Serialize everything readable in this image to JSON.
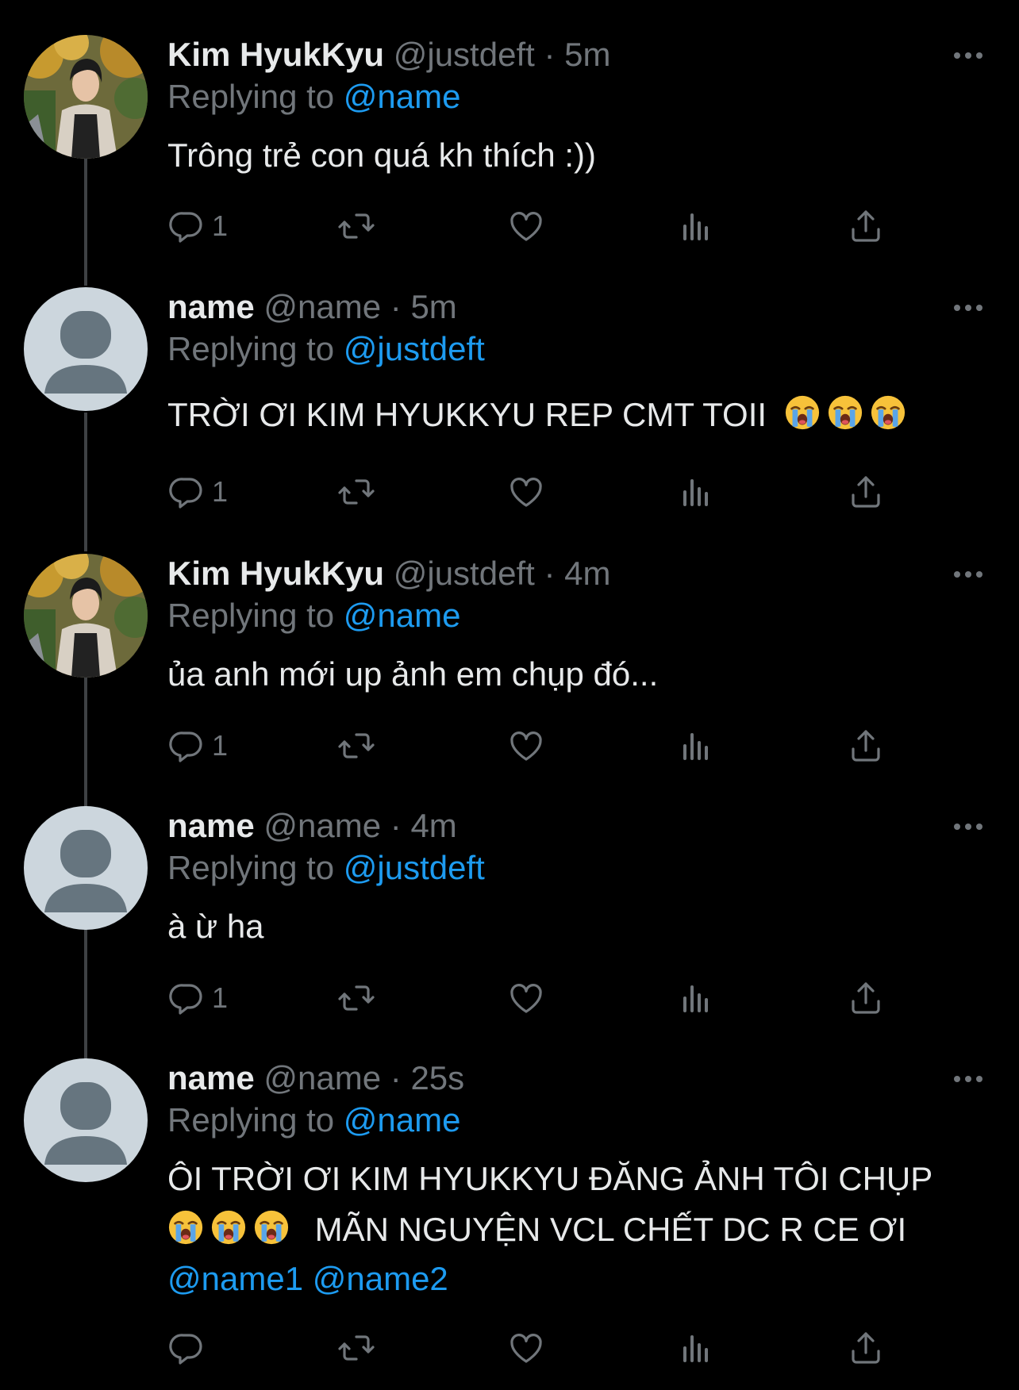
{
  "users": {
    "deft": {
      "display_name": "Kim HyukKyu",
      "handle": "@justdeft"
    },
    "name": {
      "display_name": "name",
      "handle": "@name"
    }
  },
  "tweets": [
    {
      "display_name": "Kim HyukKyu",
      "handle": "@justdeft",
      "dot": "·",
      "time": "5m",
      "replying_label": "Replying to",
      "replying_to": "@name",
      "text": "Trông trẻ con quá kh thích :))",
      "reply_count": "1"
    },
    {
      "display_name": "name",
      "handle": "@name",
      "dot": "·",
      "time": "5m",
      "replying_label": "Replying to",
      "replying_to": "@justdeft",
      "text": "TRỜI ƠI KIM HYUKKYU REP CMT TOII",
      "reply_count": "1"
    },
    {
      "display_name": "Kim HyukKyu",
      "handle": "@justdeft",
      "dot": "·",
      "time": "4m",
      "replying_label": "Replying to",
      "replying_to": "@name",
      "text": "ủa anh mới up ảnh em chụp đó...",
      "reply_count": "1"
    },
    {
      "display_name": "name",
      "handle": "@name",
      "dot": "·",
      "time": "4m",
      "replying_label": "Replying to",
      "replying_to": "@justdeft",
      "text": "à ừ ha",
      "reply_count": "1"
    },
    {
      "display_name": "name",
      "handle": "@name",
      "dot": "·",
      "time": "25s",
      "replying_label": "Replying to",
      "replying_to": "@name",
      "text_line1": "ÔI TRỜI ƠI KIM HYUKKYU ĐĂNG ẢNH TÔI CHỤP",
      "text_line2": "MÃN NGUYỆN VCL CHẾT DC R CE ƠI",
      "mention1": "@name1",
      "mention2": "@name2",
      "reply_count": ""
    }
  ],
  "icons": {
    "reply": "reply-icon",
    "retweet": "retweet-icon",
    "like": "heart-icon",
    "views": "views-icon",
    "share": "share-icon",
    "more": "more-icon",
    "emoji": "loudly-crying-face"
  },
  "colors": {
    "background": "#000000",
    "text": "#e7e9ea",
    "secondary": "#71767b",
    "accent": "#1d9bf0",
    "thread_line": "#3e4144",
    "default_avatar_bg": "#ccd6dd",
    "default_avatar_fg": "#66757f"
  }
}
